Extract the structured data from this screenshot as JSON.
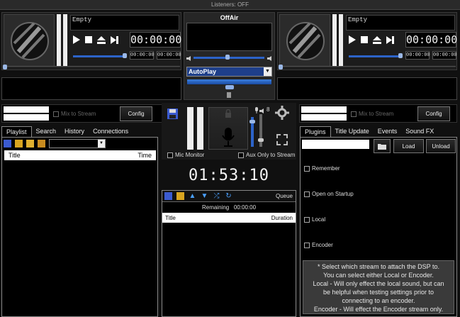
{
  "title": "Listeners: OFF",
  "left_deck": {
    "track": "Empty",
    "time": "00:00:00",
    "elapsed": "00:00:00",
    "remaining": "00:00:00",
    "volume": 0.42,
    "position": 0.0
  },
  "right_deck": {
    "track": "Empty",
    "time": "00:00:00",
    "elapsed": "00:00:00",
    "remaining": "00:00:00",
    "volume": 0.42,
    "position": 0.0
  },
  "center": {
    "status": "OffAir",
    "mode": "AutoPlay",
    "crossfade": 0.5
  },
  "left_controls": {
    "mix_label": "Mix to Stream",
    "config": "Config"
  },
  "right_controls": {
    "mix_label": "Mix to Stream",
    "config": "Config"
  },
  "left_tabs": [
    "Playlist",
    "Search",
    "History",
    "Connections"
  ],
  "playlist_columns": [
    "Title",
    "Time"
  ],
  "mic": {
    "mic_monitor": "Mic Monitor",
    "aux_only": "Aux Only to Stream",
    "level_label": "8"
  },
  "clock": "01:53:10",
  "queue": {
    "label": "Queue",
    "remaining_label": "Remaining",
    "remaining_value": "00:00:00",
    "columns": [
      "Title",
      "Duration"
    ]
  },
  "right_tabs": [
    "Plugins",
    "Title Update",
    "Events",
    "Sound FX"
  ],
  "plugins": {
    "load": "Load",
    "unload": "Unload",
    "options": [
      "Remember",
      "Open on Startup",
      "Local",
      "Encoder"
    ],
    "help_lines": [
      "* Select which stream to attach the DSP to.",
      "You can select either Local or Encoder.",
      "Local - Will only effect the local sound, but can",
      "be helpful when testing settings prior to",
      "connecting to an encoder.",
      "Encoder - Will effect the Encoder stream only."
    ]
  },
  "colors": {
    "accent": "#2c63c9",
    "background": "#101010"
  }
}
